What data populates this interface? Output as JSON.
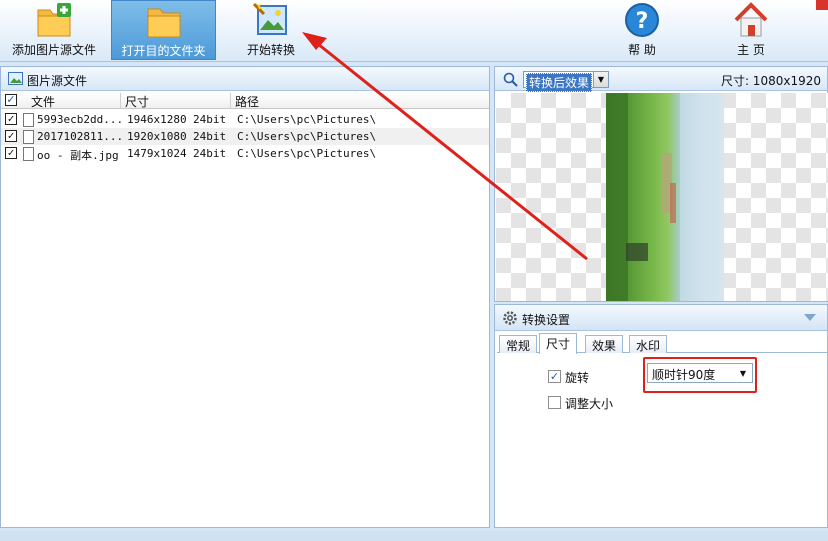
{
  "toolbar": {
    "add_source": "添加图片源文件",
    "open_folder": "打开目的文件夹",
    "start_convert": "开始转换",
    "help": "帮 助",
    "home": "主 页"
  },
  "left_panel": {
    "title": "图片源文件",
    "columns": [
      "文件",
      "尺寸",
      "路径"
    ],
    "files": [
      {
        "name": "5993ecb2dd...",
        "size": "1946x1280",
        "depth": "24bit",
        "path": "C:\\Users\\pc\\Pictures\\"
      },
      {
        "name": "2017102811...",
        "size": "1920x1080",
        "depth": "24bit",
        "path": "C:\\Users\\pc\\Pictures\\"
      },
      {
        "name": "oo - 副本.jpg",
        "size": "1479x1024",
        "depth": "24bit",
        "path": "C:\\Users\\pc\\Pictures\\"
      }
    ]
  },
  "preview": {
    "view_select": "转换后效果",
    "size_text": "尺寸: 1080x1920"
  },
  "settings": {
    "title": "转换设置",
    "tabs": [
      "常规",
      "尺寸",
      "效果",
      "水印"
    ],
    "active_tab": "尺寸",
    "rotate_label": "旋转",
    "rotate_checked": true,
    "rotate_value": "顺时针90度",
    "resize_label": "调整大小",
    "resize_checked": false
  },
  "colors": {
    "accent": "#4d9ad8",
    "annotation": "#e0201a"
  },
  "icons": [
    "folder-add-icon",
    "folder-open-icon",
    "magic-wand-icon",
    "help-icon",
    "home-icon",
    "search-icon",
    "gear-icon"
  ]
}
